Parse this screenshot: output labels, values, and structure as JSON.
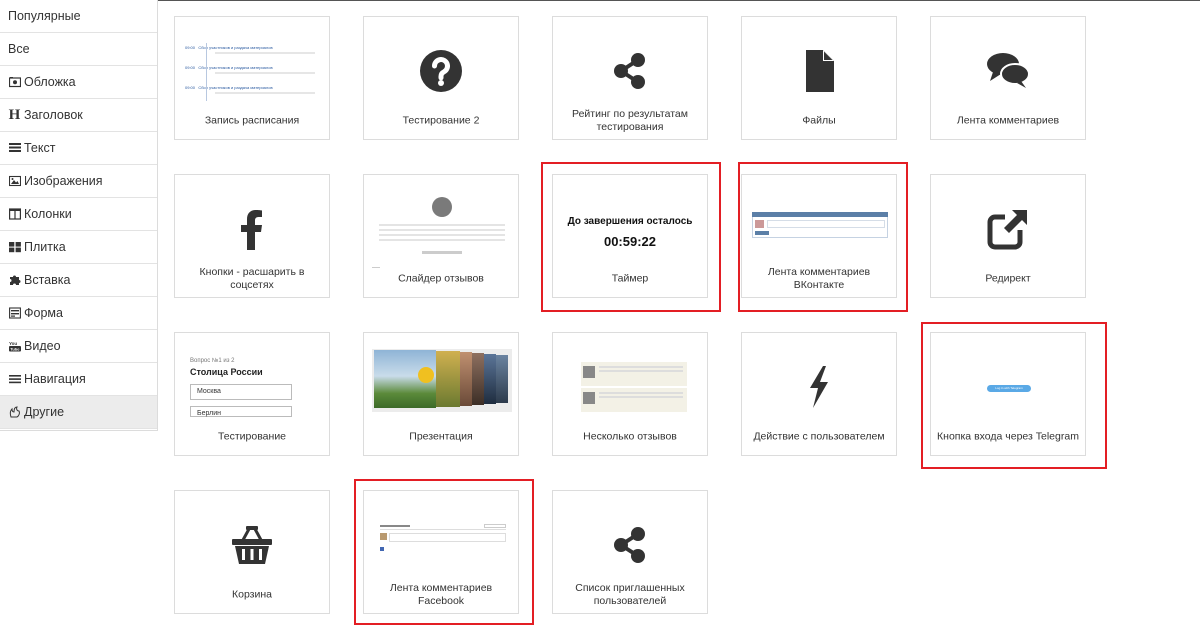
{
  "sidebar": {
    "items": [
      {
        "label": "Популярные",
        "icon": ""
      },
      {
        "label": "Все",
        "icon": ""
      },
      {
        "label": "Обложка",
        "icon": "cover-icon"
      },
      {
        "label": "Заголовок",
        "icon": "heading-icon"
      },
      {
        "label": "Текст",
        "icon": "text-icon"
      },
      {
        "label": "Изображения",
        "icon": "image-icon"
      },
      {
        "label": "Колонки",
        "icon": "columns-icon"
      },
      {
        "label": "Плитка",
        "icon": "tiles-icon"
      },
      {
        "label": "Вставка",
        "icon": "puzzle-icon"
      },
      {
        "label": "Форма",
        "icon": "form-icon"
      },
      {
        "label": "Видео",
        "icon": "youtube-icon"
      },
      {
        "label": "Навигация",
        "icon": "menu-icon"
      },
      {
        "label": "Другие",
        "icon": "other-icon"
      }
    ],
    "active_index": 12,
    "heading_glyph": "H"
  },
  "blocks": [
    {
      "label": "Запись расписания",
      "preview": "schedule"
    },
    {
      "label": "Тестирование 2",
      "preview": "question-icon"
    },
    {
      "label": "Рейтинг по результатам тестирования",
      "preview": "share-icon"
    },
    {
      "label": "Файлы",
      "preview": "file-icon"
    },
    {
      "label": "Лента комментариев",
      "preview": "comments-icon"
    },
    {
      "label": "Кнопки - расшарить в соцсетях",
      "preview": "facebook-icon"
    },
    {
      "label": "Слайдер отзывов",
      "preview": "reviews-slider"
    },
    {
      "label": "Таймер",
      "preview": "timer",
      "highlighted": true
    },
    {
      "label": "Лента комментариев ВКонтакте",
      "preview": "vk-comments",
      "highlighted": true
    },
    {
      "label": "Редирект",
      "preview": "external-link-icon"
    },
    {
      "label": "Тестирование",
      "preview": "quiz"
    },
    {
      "label": "Презентация",
      "preview": "presentation"
    },
    {
      "label": "Несколько отзывов",
      "preview": "reviews"
    },
    {
      "label": "Действие с пользователем",
      "preview": "bolt-icon"
    },
    {
      "label": "Кнопка входа через Telegram",
      "preview": "telegram-button",
      "highlighted": true
    },
    {
      "label": "Корзина",
      "preview": "basket-icon"
    },
    {
      "label": "Лента комментариев Facebook",
      "preview": "fb-comments",
      "highlighted": true
    },
    {
      "label": "Список приглашенных пользователей",
      "preview": "share-icon"
    }
  ],
  "previews": {
    "schedule_time": "09:00",
    "schedule_title": "Сбор участников и раздача материалов",
    "timer_title": "До завершения осталось",
    "timer_value": "00:59:22",
    "quiz_counter": "Вопрос №1 из 2",
    "quiz_title": "Столица России",
    "quiz_options": [
      "Москва",
      "Берлин"
    ],
    "telegram_button": "Log in with Telegram"
  },
  "colors": {
    "highlight": "#e31e24",
    "accent": "#2a5aa0",
    "icon": "#333333",
    "sidebar_active": "#ececec"
  }
}
